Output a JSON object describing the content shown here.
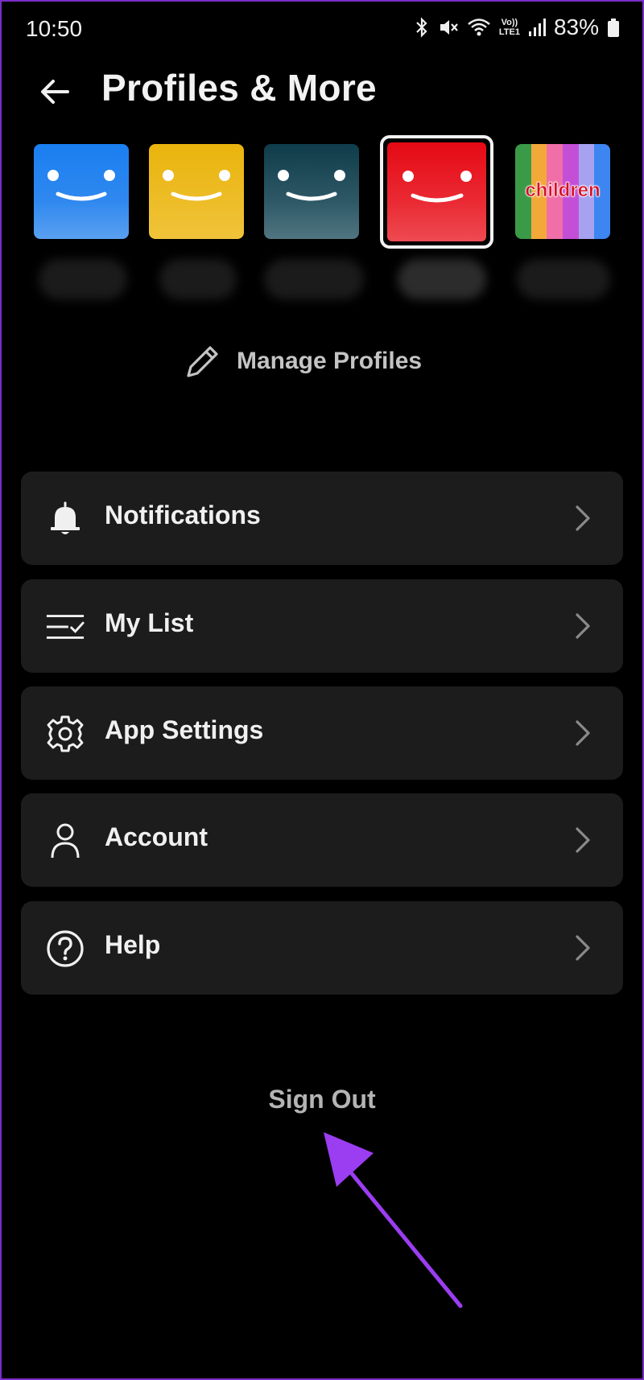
{
  "status_bar": {
    "time": "10:50",
    "lte_top": "Vo))",
    "lte_bottom": "LTE1",
    "battery": "83%",
    "icons": [
      "bluetooth-icon",
      "mute-icon",
      "wifi-icon",
      "signal-icon",
      "battery-icon"
    ]
  },
  "header": {
    "title": "Profiles & More",
    "back_icon": "arrow-left-icon"
  },
  "profiles": {
    "items": [
      {
        "color": "#1a7ff0",
        "type": "smiley"
      },
      {
        "color": "#e9b40c",
        "type": "smiley"
      },
      {
        "color": "#0f3c4a",
        "type": "smiley"
      },
      {
        "color": "#e50914",
        "type": "smiley",
        "selected": true
      },
      {
        "type": "kids",
        "label": "children"
      }
    ],
    "kids_label": "children"
  },
  "manage_profiles": {
    "label": "Manage Profiles",
    "icon": "pencil-icon"
  },
  "menu": {
    "items": [
      {
        "label": "Notifications",
        "icon": "bell-icon"
      },
      {
        "label": "My List",
        "icon": "list-check-icon"
      },
      {
        "label": "App Settings",
        "icon": "gear-icon"
      },
      {
        "label": "Account",
        "icon": "person-icon"
      },
      {
        "label": "Help",
        "icon": "help-icon"
      }
    ]
  },
  "sign_out": {
    "label": "Sign Out"
  },
  "colors": {
    "background": "#000000",
    "card": "#1c1c1c",
    "netflix_red": "#e50914",
    "annotation_arrow": "#9b3df0"
  }
}
